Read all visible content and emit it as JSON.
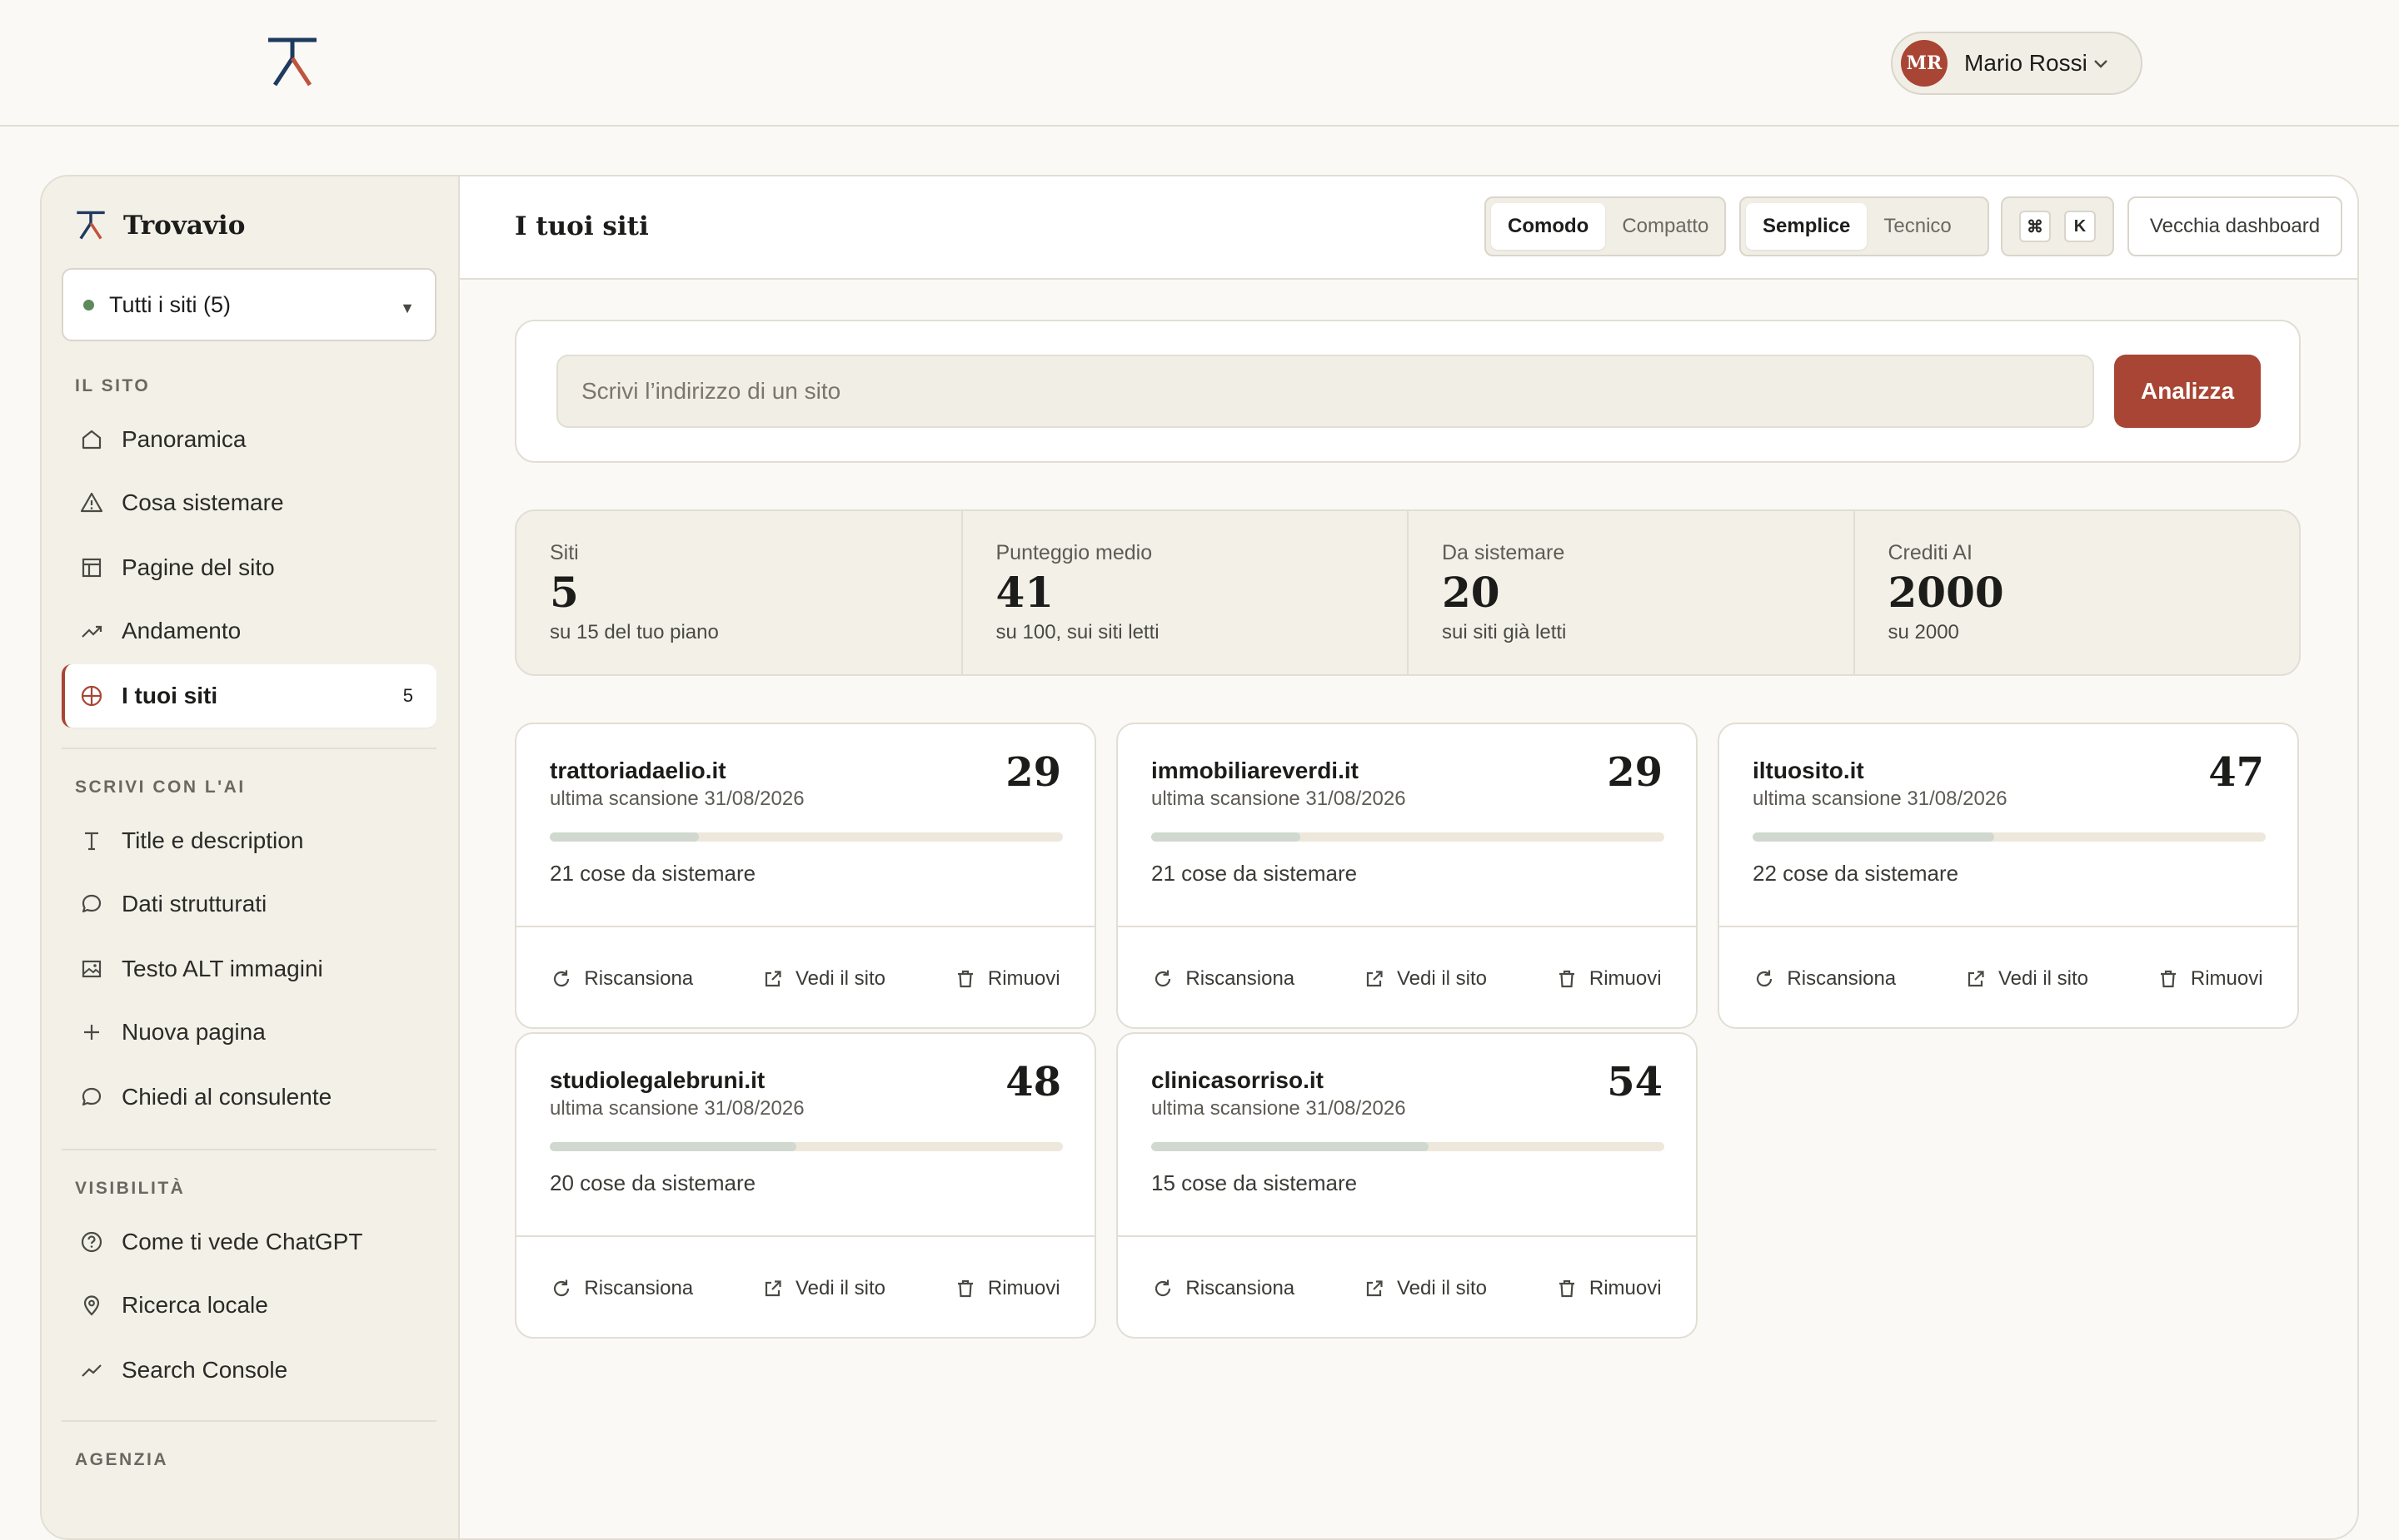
{
  "user": {
    "initials": "MR",
    "name": "Mario Rossi"
  },
  "sidebar": {
    "brand": "Trovavio",
    "site_selector": "Tutti i siti (5)",
    "sections": [
      {
        "title": "IL SITO",
        "items": [
          {
            "label": "Panoramica",
            "icon": "home-icon"
          },
          {
            "label": "Cosa sistemare",
            "icon": "warning-icon"
          },
          {
            "label": "Pagine del sito",
            "icon": "layout-icon"
          },
          {
            "label": "Andamento",
            "icon": "trend-up-icon"
          },
          {
            "label": "I tuoi siti",
            "icon": "globe-icon",
            "active": true,
            "badge": "5"
          }
        ]
      },
      {
        "title": "SCRIVI CON L'AI",
        "items": [
          {
            "label": "Title e description",
            "icon": "text-icon"
          },
          {
            "label": "Dati strutturati",
            "icon": "chat-icon"
          },
          {
            "label": "Testo ALT immagini",
            "icon": "image-icon"
          },
          {
            "label": "Nuova pagina",
            "icon": "plus-icon"
          },
          {
            "label": "Chiedi al consulente",
            "icon": "chat-icon"
          }
        ]
      },
      {
        "title": "VISIBILITÀ",
        "items": [
          {
            "label": "Come ti vede ChatGPT",
            "icon": "help-circle-icon"
          },
          {
            "label": "Ricerca locale",
            "icon": "pin-icon"
          },
          {
            "label": "Search Console",
            "icon": "trend-line-icon"
          }
        ]
      },
      {
        "title": "AGENZIA",
        "items": []
      }
    ]
  },
  "header": {
    "title": "I tuoi siti",
    "density": {
      "options": [
        "Comodo",
        "Compatto"
      ],
      "selected": "Comodo"
    },
    "mode": {
      "options": [
        "Semplice",
        "Tecnico"
      ],
      "selected": "Semplice"
    },
    "shortcut": [
      "⌘",
      "K"
    ],
    "old_dashboard": "Vecchia dashboard"
  },
  "search": {
    "placeholder": "Scrivi l’indirizzo di un sito",
    "button": "Analizza"
  },
  "stats": [
    {
      "label": "Siti",
      "value": "5",
      "sub": "su 15 del tuo piano"
    },
    {
      "label": "Punteggio medio",
      "value": "41",
      "sub": "su 100, sui siti letti"
    },
    {
      "label": "Da sistemare",
      "value": "20",
      "sub": "sui siti già letti"
    },
    {
      "label": "Crediti AI",
      "value": "2000",
      "sub": "su 2000"
    }
  ],
  "site_actions": {
    "rescan": "Riscansiona",
    "view": "Vedi il sito",
    "remove": "Rimuovi"
  },
  "sites": [
    {
      "domain": "trattoriadaelio.it",
      "scan": "ultima scansione 31/08/2026",
      "score": "29",
      "score_value": 29,
      "issues": "21 cose da sistemare"
    },
    {
      "domain": "immobiliareverdi.it",
      "scan": "ultima scansione 31/08/2026",
      "score": "29",
      "score_value": 29,
      "issues": "21 cose da sistemare"
    },
    {
      "domain": "iltuosito.it",
      "scan": "ultima scansione 31/08/2026",
      "score": "47",
      "score_value": 47,
      "issues": "22 cose da sistemare"
    },
    {
      "domain": "studiolegalebruni.it",
      "scan": "ultima scansione 31/08/2026",
      "score": "48",
      "score_value": 48,
      "issues": "20 cose da sistemare"
    },
    {
      "domain": "clinicasorriso.it",
      "scan": "ultima scansione 31/08/2026",
      "score": "54",
      "score_value": 54,
      "issues": "15 cose da sistemare"
    }
  ],
  "colors": {
    "accent": "#A84534",
    "logo_blue": "#1F3A5F",
    "logo_red": "#C0533E",
    "status_green": "#5E8A5B"
  }
}
